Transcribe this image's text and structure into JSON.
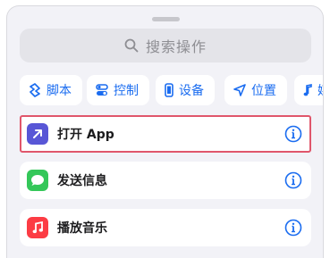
{
  "search": {
    "placeholder": "搜索操作"
  },
  "categories": [
    {
      "label": "脚本",
      "icon": "script-icon"
    },
    {
      "label": "控制",
      "icon": "controls-icon"
    },
    {
      "label": "设备",
      "icon": "device-icon"
    },
    {
      "label": "位置",
      "icon": "location-arrow-icon"
    },
    {
      "label": "媒体",
      "icon": "music-note-icon"
    }
  ],
  "actions": [
    {
      "label": "打开 App",
      "icon": "open-app-icon",
      "icon_color": "#5856d6",
      "selected": true
    },
    {
      "label": "发送信息",
      "icon": "messages-icon",
      "icon_color": "#34c759",
      "selected": false
    },
    {
      "label": "播放音乐",
      "icon": "music-icon",
      "icon_color": "#fc3c44",
      "selected": false
    }
  ],
  "colors": {
    "accent": "#1a6cf0",
    "selection_outline": "#e0566b",
    "sheet_background": "#f2f2f7"
  }
}
